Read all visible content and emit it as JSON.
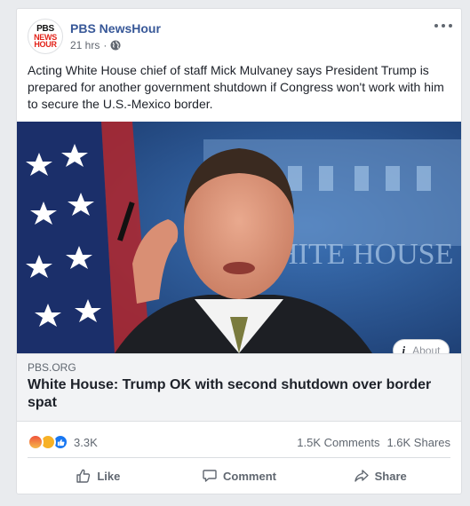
{
  "post": {
    "page_name": "PBS NewsHour",
    "avatar_line1": "PBS",
    "avatar_line2": "NEWS",
    "avatar_line3": "HOUR",
    "timestamp": "21 hrs",
    "separator": "·",
    "privacy_icon": "globe-icon",
    "more_icon": "more-options-icon",
    "text": "Acting White House chief of staff Mick Mulvaney says President Trump is prepared for another government shutdown if Congress won't work with him to secure the U.S.-Mexico border."
  },
  "link": {
    "image_backdrop_text": "WHITE HOUSE",
    "about_icon": "info-icon",
    "about_label": "About",
    "domain": "PBS.ORG",
    "headline": "White House: Trump OK with second shutdown over border spat"
  },
  "stats": {
    "reaction_icons": [
      "angry-icon",
      "haha-icon",
      "like-icon"
    ],
    "reaction_count": "3.3K",
    "comments": "1.5K Comments",
    "shares": "1.6K Shares"
  },
  "actions": {
    "like_label": "Like",
    "comment_label": "Comment",
    "share_label": "Share"
  },
  "colors": {
    "page_name": "#385898",
    "like_blue": "#1877f2",
    "text": "#1d2129",
    "secondary_text": "#606770",
    "background": "#e9ebee"
  }
}
